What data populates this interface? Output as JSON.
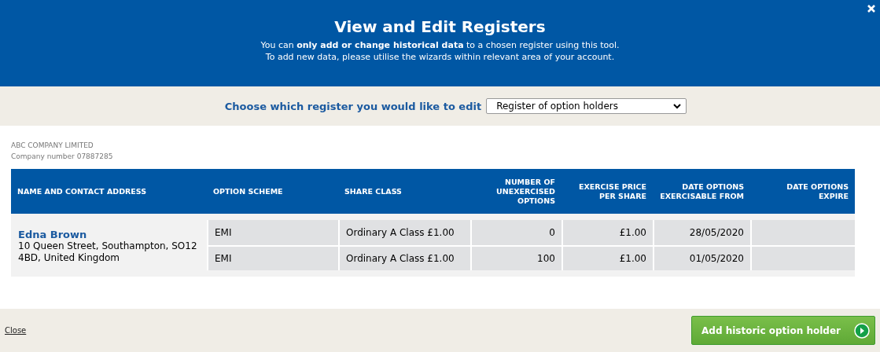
{
  "header": {
    "title": "View and Edit Registers",
    "lines": [
      "You can **only add or change historical data** to a chosen register using this tool.",
      "To add new data, please utilise the wizards within relevant area of your account."
    ]
  },
  "register_picker": {
    "label": "Choose which register you would like to edit",
    "value": "Register of option holders"
  },
  "company": {
    "name": "ABC COMPANY LIMITED",
    "number": "Company number 07887285"
  },
  "table": {
    "columns": [
      {
        "label": "NAME AND CONTACT ADDRESS",
        "kind": "text"
      },
      {
        "label": "OPTION SCHEME",
        "kind": "text"
      },
      {
        "label": "SHARE CLASS",
        "kind": "text"
      },
      {
        "label": "NUMBER OF UNEXERCISED OPTIONS",
        "kind": "number"
      },
      {
        "label": "EXERCISE PRICE PER SHARE",
        "kind": "number"
      },
      {
        "label": "DATE OPTIONS EXERCISABLE FROM",
        "kind": "number"
      },
      {
        "label": "DATE OPTIONS EXPIRE",
        "kind": "number"
      }
    ],
    "holders": [
      {
        "name": "Edna Brown",
        "address": "10 Queen Street, Southampton, SO12 4BD, United Kingdom",
        "rows": [
          [
            "EMI",
            "Ordinary A Class £1.00",
            "0",
            "£1.00",
            "28/05/2020",
            null
          ],
          [
            "EMI",
            "Ordinary A Class £1.00",
            "100",
            "£1.00",
            "01/05/2020",
            null
          ]
        ]
      }
    ]
  },
  "footer": {
    "close_link": "Close",
    "add_button": "Add historic option holder"
  }
}
